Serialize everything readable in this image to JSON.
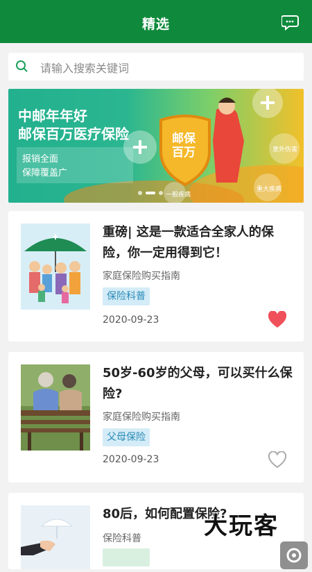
{
  "header": {
    "title": "精选",
    "message_icon": "chat-bubbles-icon"
  },
  "search": {
    "placeholder": "请输入搜索关键词",
    "icon": "search-icon"
  },
  "banner": {
    "headline_line1": "中邮年年好",
    "headline_line2": "邮保百万医疗保险",
    "sub_line1": "报销全面",
    "sub_line2": "保障覆盖广",
    "shield_text_line1": "邮保",
    "shield_text_line2": "百万",
    "bubble1": "意外伤害",
    "bubble2": "重大疾病",
    "bubble3": "一般疾病"
  },
  "articles": [
    {
      "title": "重磅| 这是一款适合全家人的保险，你一定用得到它！",
      "category": "家庭保险购买指南",
      "tag": "保险科普",
      "date": "2020-09-23",
      "liked": true
    },
    {
      "title": "50岁-60岁的父母，可以买什么保险?",
      "category": "家庭保险购买指南",
      "tag": "父母保险",
      "date": "2020-09-23",
      "liked": false
    },
    {
      "title": "80后，如何配置保险?",
      "category": "保险科普",
      "tag": "",
      "date": "",
      "liked": false
    }
  ],
  "watermark": "大玩客",
  "colors": {
    "primary": "#0f8a3c",
    "heart_active": "#f0505a",
    "tag_bg": "#d4ecf7",
    "tag_text": "#2a8bb8"
  }
}
